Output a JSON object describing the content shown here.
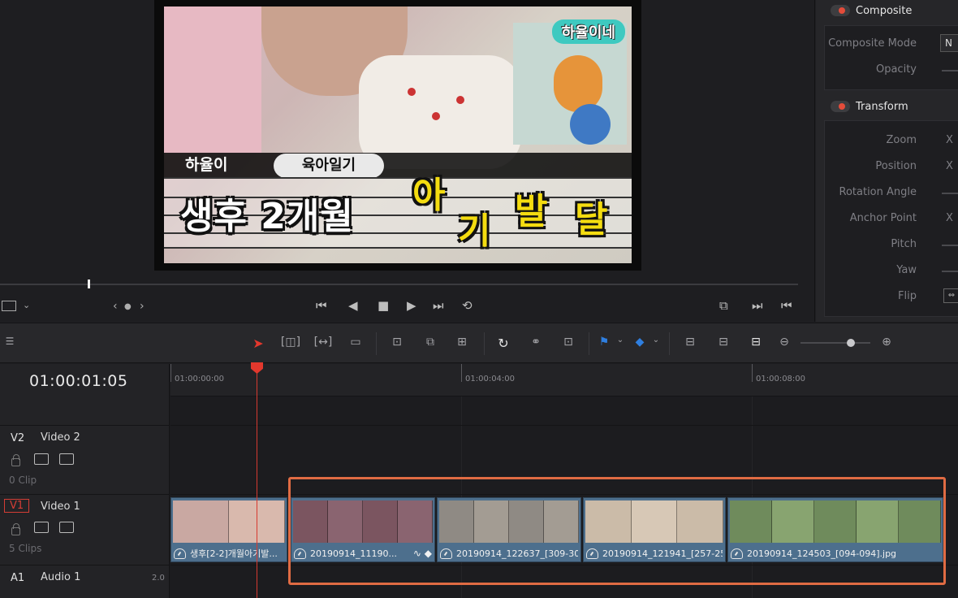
{
  "viewer": {
    "thumbnail": {
      "badge": "하율이네",
      "name": "하율이",
      "pill": "육아일기",
      "title": "생후 2개월",
      "yellow1": "아",
      "yellow2": "기",
      "yellow3": "발",
      "yellow4": "달"
    },
    "nav_prev": "‹",
    "nav_dot": "●",
    "nav_next": "›"
  },
  "inspector": {
    "composite": {
      "title": "Composite",
      "composite_mode_label": "Composite Mode",
      "composite_mode_value": "N",
      "opacity_label": "Opacity"
    },
    "transform": {
      "title": "Transform",
      "zoom_label": "Zoom",
      "position_label": "Position",
      "rotation_label": "Rotation Angle",
      "anchor_label": "Anchor Point",
      "pitch_label": "Pitch",
      "yaw_label": "Yaw",
      "flip_label": "Flip",
      "x_label": "X"
    }
  },
  "timeline": {
    "timecode": "01:00:01:05",
    "ruler": [
      "01:00:00:00",
      "01:00:04:00",
      "01:00:08:00"
    ],
    "tracks": [
      {
        "id": "V2",
        "name": "Video 2",
        "count": "0 Clip"
      },
      {
        "id": "V1",
        "name": "Video 1",
        "count": "5 Clips"
      },
      {
        "id": "A1",
        "name": "Audio 1",
        "level": "2.0"
      }
    ],
    "clips": [
      {
        "label": "생후[2-2]개월아기발...",
        "color": "#4d6f8d"
      },
      {
        "label": "20190914_11190...",
        "color": "#4d6f8d"
      },
      {
        "label": "20190914_122637_[309-30...",
        "color": "#4d6f8d"
      },
      {
        "label": "20190914_121941_[257-25...",
        "color": "#4d6f8d"
      },
      {
        "label": "20190914_124503_[094-094].jpg",
        "color": "#4d6f8d"
      }
    ]
  },
  "colors": {
    "accent_red": "#e3382d",
    "highlight": "#e06b43",
    "clip_blue": "#4d6f8d"
  }
}
